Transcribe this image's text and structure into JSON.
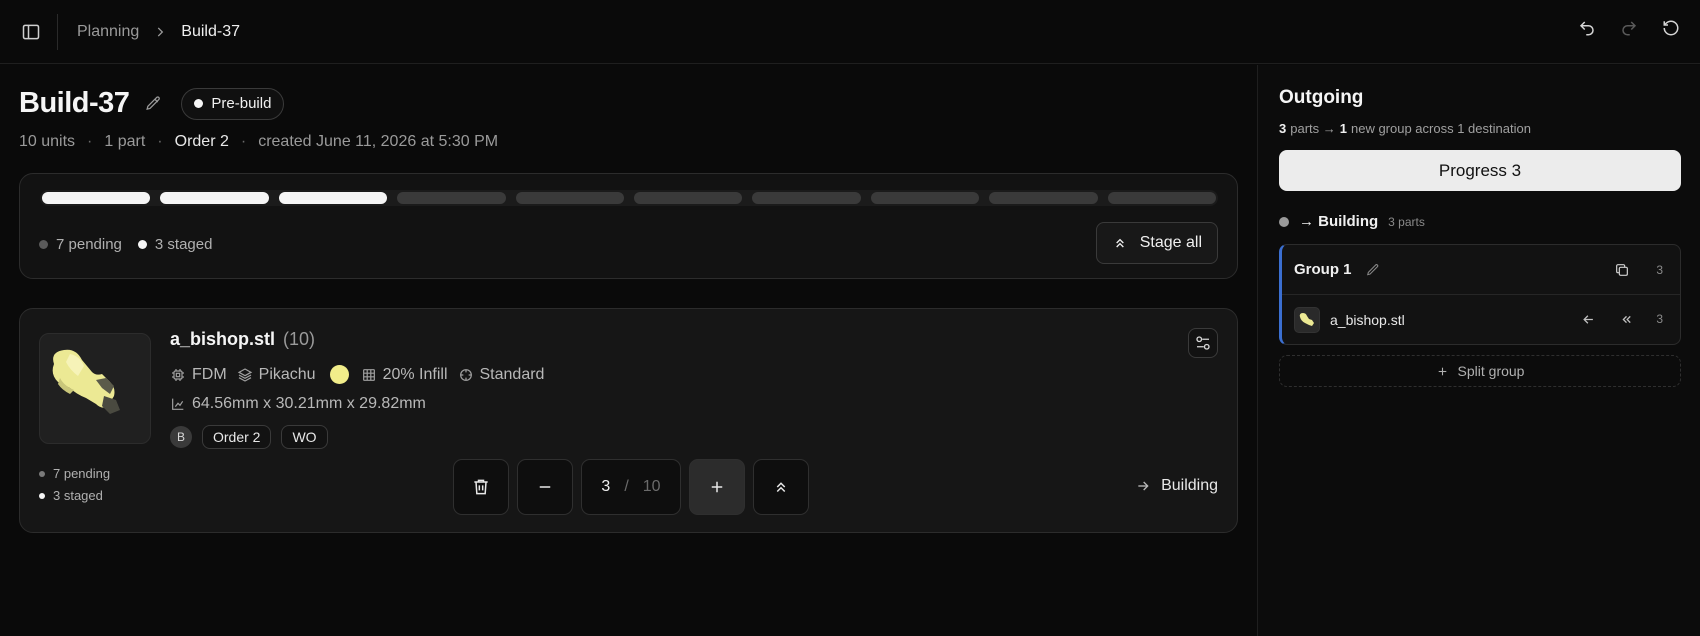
{
  "topbar": {
    "breadcrumbs": [
      "Planning",
      "Build-37"
    ],
    "icons": {
      "sidebar": "sidebar-toggle-icon",
      "undo": "undo-icon",
      "redo": "redo-icon",
      "reset": "reset-icon"
    }
  },
  "build": {
    "title": "Build-37",
    "status": "Pre-build",
    "meta": {
      "units": "10 units",
      "parts": "1 part",
      "order": "Order 2",
      "created": "created June 11, 2026 at 5:30 PM"
    },
    "progress": {
      "total_segments": 10,
      "staged_segments": 3
    },
    "legend": {
      "pending": "7 pending",
      "staged": "3 staged"
    },
    "stage_all_label": "Stage all"
  },
  "part": {
    "name": "a_bishop.stl",
    "count": "(10)",
    "process": "FDM",
    "material": "Pikachu",
    "color": "#f1ed8a",
    "infill": "20% Infill",
    "quality": "Standard",
    "dimensions": "64.56mm x 30.21mm x 29.82mm",
    "avatar": "B",
    "tags": [
      "Order 2",
      "WO"
    ],
    "legend": {
      "pending": "7 pending",
      "staged": "3 staged"
    },
    "quantity": {
      "value": "3",
      "separator": "/",
      "total": "10"
    },
    "destination": "Building"
  },
  "outgoing": {
    "title": "Outgoing",
    "summary": {
      "parts_num": "3",
      "parts_text": "parts →",
      "groups_num": "1",
      "groups_text": "new group across 1 destination"
    },
    "progress_label": "Progress 3",
    "destination": {
      "label": "→ Building",
      "count": "3 parts"
    },
    "group": {
      "name": "Group 1",
      "count": "3",
      "item": {
        "name": "a_bishop.stl",
        "count": "3"
      }
    },
    "split_label": "Split group"
  }
}
